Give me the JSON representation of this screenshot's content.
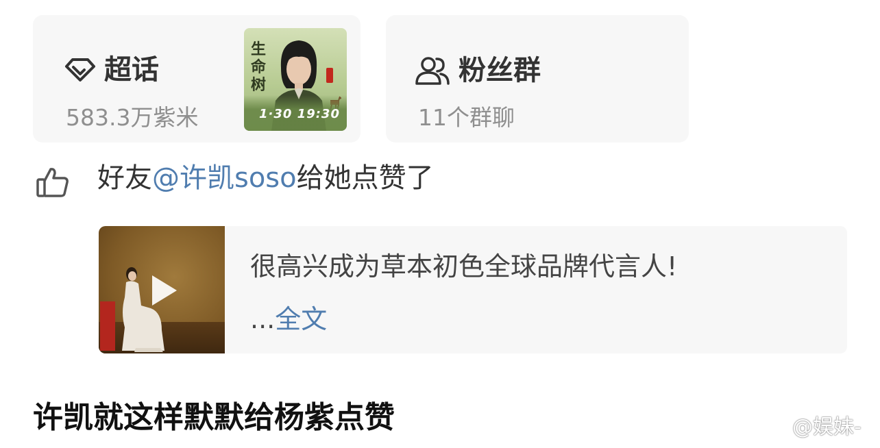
{
  "supertopic": {
    "title": "超话",
    "count": "583.3万紫米",
    "poster": {
      "vertical_title": "生命树",
      "date_text": "1·30 19:30"
    }
  },
  "fan_group": {
    "title": "粉丝群",
    "count": "11个群聊"
  },
  "like_notice": {
    "prefix": "好友",
    "mention": "@许凯soso",
    "suffix": "给她点赞了"
  },
  "post": {
    "text": "很高兴成为草本初色全球品牌代言人!",
    "ellipsis": "...",
    "more_link": "全文"
  },
  "caption": "许凯就这样默默给杨紫点赞",
  "watermark": "@娱妹-",
  "colors": {
    "link": "#507daf",
    "card_bg": "#f7f7f7",
    "muted_text": "#8f8f8f"
  }
}
